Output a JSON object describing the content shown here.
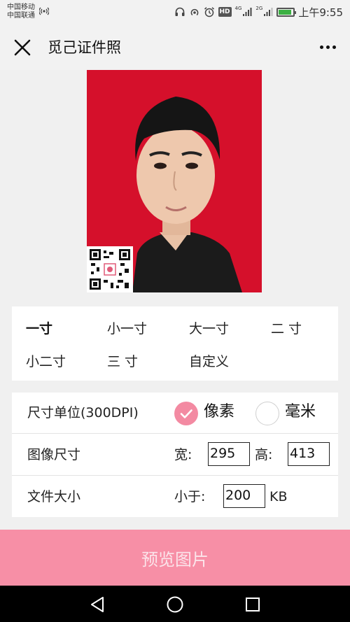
{
  "status": {
    "carrier1": "中国移动",
    "carrier2": "中国联通",
    "hd": "HD",
    "net1": "4G",
    "net2": "2G",
    "time": "上午9:55",
    "battery_level": 0.9
  },
  "header": {
    "title": "觅己证件照",
    "close_icon": "close-icon",
    "more_icon": "more-icon"
  },
  "photo": {
    "background_color": "#d5102b"
  },
  "sizes": [
    {
      "label": "一寸",
      "active": true
    },
    {
      "label": "小一寸",
      "active": false
    },
    {
      "label": "大一寸",
      "active": false
    },
    {
      "label": "二 寸",
      "active": false
    },
    {
      "label": "小二寸",
      "active": false
    },
    {
      "label": "三 寸",
      "active": false
    },
    {
      "label": "自定义",
      "active": false
    }
  ],
  "settings": {
    "unit_label": "尺寸单位(300DPI)",
    "unit_options": [
      {
        "label": "像素",
        "checked": true
      },
      {
        "label": "毫米",
        "checked": false
      }
    ],
    "image_size_label": "图像尺寸",
    "width_label": "宽:",
    "width_value": "295",
    "height_label": "高:",
    "height_value": "413",
    "file_size_label": "文件大小",
    "less_than_label": "小于:",
    "file_size_value": "200",
    "file_size_unit": "KB"
  },
  "actions": {
    "preview_label": "预览图片"
  },
  "colors": {
    "accent": "#f78fa6",
    "radio_checked": "#f38aa2",
    "photo_bg": "#d5102b"
  }
}
